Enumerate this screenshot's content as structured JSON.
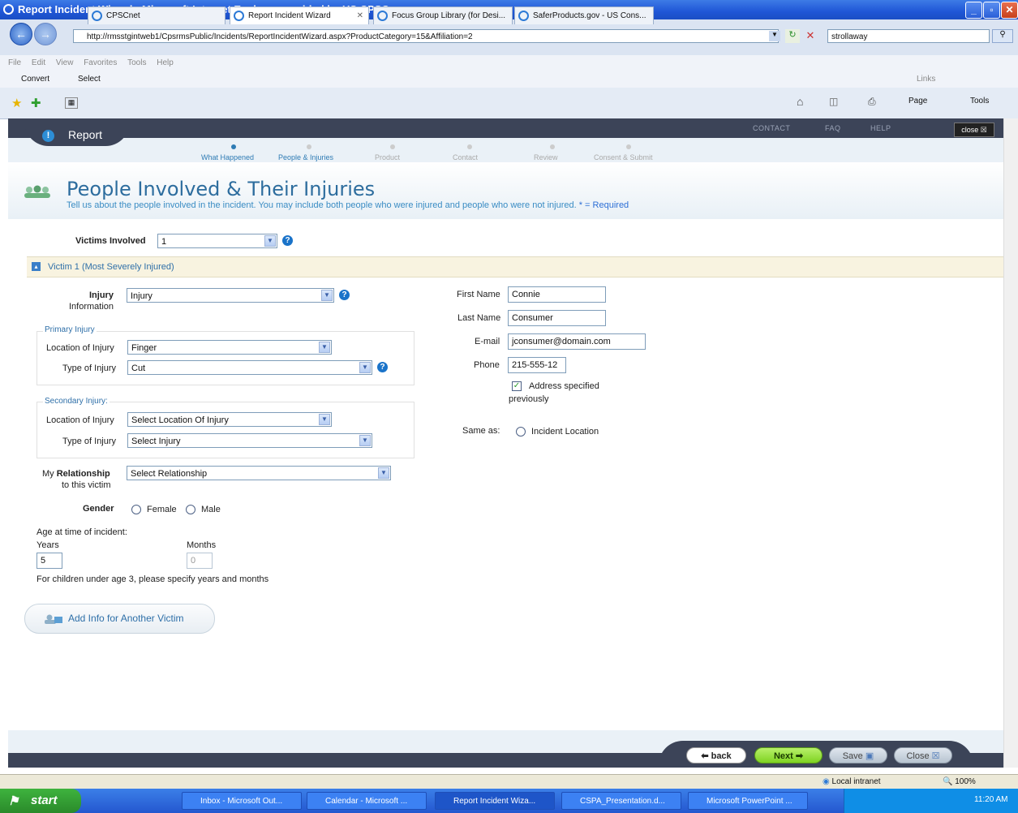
{
  "window": {
    "title": "Report Incident Wizard - Microsoft Internet Explorer provided by US CPSC",
    "url": "http://rmsstgintweb1/CpsrmsPublic/Incidents/ReportIncidentWizard.aspx?ProductCategory=15&Affiliation=2",
    "search_value": "strollaway",
    "menu": [
      "File",
      "Edit",
      "View",
      "Favorites",
      "Tools",
      "Help"
    ],
    "cmd": {
      "convert": "Convert",
      "select": "Select",
      "links": "Links"
    },
    "tabs": [
      "CPSCnet",
      "Report Incident Wizard",
      "Focus Group Library (for Desi...",
      "SaferProducts.gov - US Cons..."
    ],
    "toolbar_right": {
      "page": "Page",
      "tools": "Tools"
    }
  },
  "header": {
    "report_label": "Report",
    "links": [
      "CONTACT",
      "FAQ",
      "HELP"
    ],
    "close_label": "close"
  },
  "steps": [
    "What Happened",
    "People & Injuries",
    "Product",
    "Contact",
    "Review",
    "Consent & Submit"
  ],
  "page": {
    "title": "People Involved & Their Injuries",
    "subtitle_prefix": "Tell us about the people involved in the incident. You may include both people who were injured and people who were not injured. ",
    "required_note": "* = Required"
  },
  "form": {
    "victims_label": "Victims Involved",
    "victims_value": "1",
    "victim_section": "Victim 1 (Most Severely Injured)",
    "injury_label": "Injury",
    "injury_label2": "Information",
    "injury_value": "Injury",
    "primary_legend": "Primary Injury",
    "location_label": "Location of Injury",
    "type_label": "Type of Injury",
    "primary_location": "Finger",
    "primary_type": "Cut",
    "secondary_legend": "Secondary Injury:",
    "secondary_location": "Select Location Of Injury",
    "secondary_type": "Select Injury",
    "relationship_prefix": "My ",
    "relationship_bold": "Relationship",
    "relationship_suffix": "to this victim",
    "relationship_value": "Select Relationship",
    "gender_label": "Gender",
    "female": "Female",
    "male": "Male",
    "age_label": "Age at time of incident:",
    "years_label": "Years",
    "months_label": "Months",
    "years_value": "5",
    "months_value": "0",
    "age_note": "For children under age 3, please specify years and months",
    "first_name_label": "First Name",
    "first_name": "Connie",
    "last_name_label": "Last Name",
    "last_name": "Consumer",
    "email_label": "E-mail",
    "email": "jconsumer@domain.com",
    "phone_label": "Phone",
    "phone": "215-555-12",
    "address_check": "Address specified",
    "address_check2": "previously",
    "same_as_label": "Same as:",
    "incident_location": "Incident Location",
    "add_victim": "Add Info for Another Victim"
  },
  "nav": {
    "back": "back",
    "next": "Next",
    "save": "Save",
    "close": "Close"
  },
  "status": {
    "zone": "Local intranet",
    "zoom": "100%"
  },
  "taskbar": {
    "start": "start",
    "items": [
      "Inbox - Microsoft Out...",
      "Calendar - Microsoft ...",
      "Report Incident Wiza...",
      "CSPA_Presentation.d...",
      "Microsoft PowerPoint ..."
    ],
    "time": "11:20 AM"
  },
  "colors": {
    "accent": "#2d6d9e",
    "band": "#3c4458",
    "next": "#7ed321",
    "required": "#3a8cc4"
  }
}
